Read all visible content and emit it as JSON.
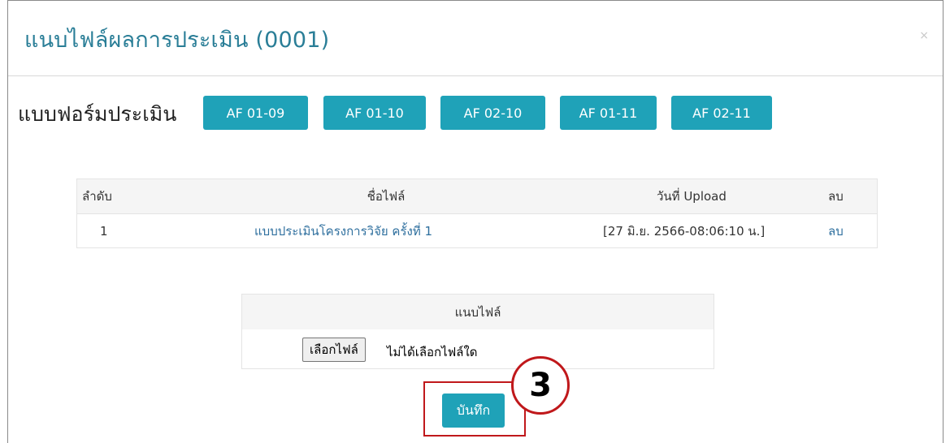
{
  "modal": {
    "title": "แนบไฟล์ผลการประเมิน (0001)",
    "close_glyph": "×"
  },
  "assessment_forms": {
    "label": "แบบฟอร์มประเมิน",
    "buttons": [
      "AF 01-09",
      "AF 01-10",
      "AF 02-10",
      "AF 01-11",
      "AF 02-11"
    ]
  },
  "file_table": {
    "headers": [
      "ลำดับ",
      "ชื่อไฟล์",
      "วันที่ Upload",
      "ลบ"
    ],
    "rows": [
      {
        "no": "1",
        "filename": "แบบประเมินโครงการวิจัย ครั้งที่ 1",
        "upload_date": "[27 มิ.ย. 2566-08:06:10 น.]",
        "delete": "ลบ"
      }
    ]
  },
  "upload": {
    "header": "แนบไฟล์",
    "choose_label": "เลือกไฟล์",
    "status": "ไม่ได้เลือกไฟล์ใด"
  },
  "save_button": "บันทึก",
  "step_marker": "3",
  "colors": {
    "accent": "#1fa2b8",
    "title": "#2a7e97",
    "link": "#2e6f9e",
    "highlight": "#c0181b"
  }
}
